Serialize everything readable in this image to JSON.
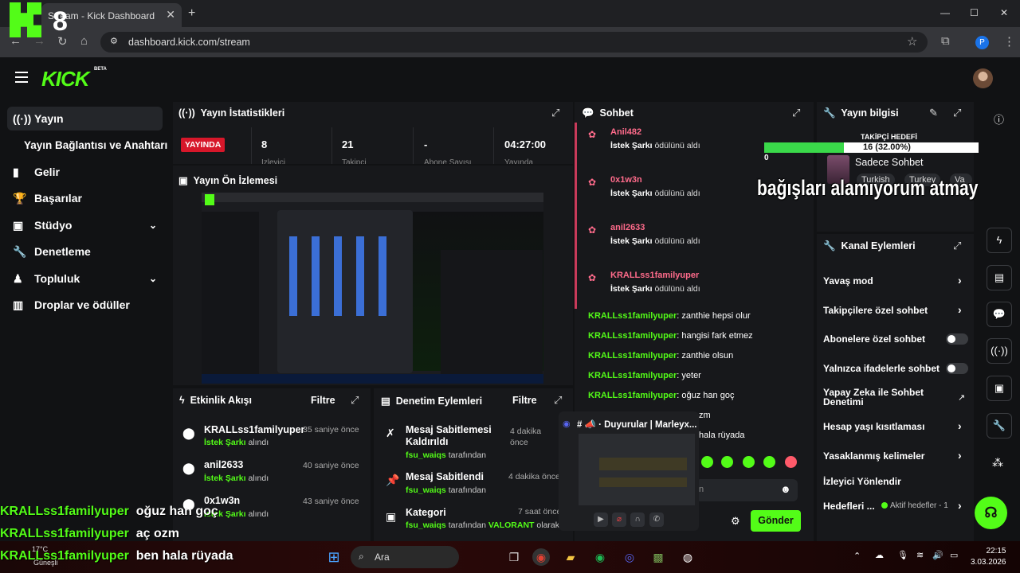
{
  "browser": {
    "tab_title": "Stream - Kick Dashboard",
    "url": "dashboard.kick.com/stream",
    "profile_initial": "P"
  },
  "overlay": {
    "logo_number": "8",
    "top_message": "bağışları alamıyorum atmayın",
    "chat": [
      {
        "user": "KRALLss1familyuper",
        "text": "oğuz han goç"
      },
      {
        "user": "KRALLss1familyuper",
        "text": "aç ozm"
      },
      {
        "user": "KRALLss1familyuper",
        "text": "ben hala rüyada"
      }
    ]
  },
  "brand": {
    "name": "KICK",
    "badge": "BETA"
  },
  "sidebar": {
    "items": [
      {
        "label": "Yayın",
        "icon": "broadcast-icon"
      },
      {
        "label": "Yayın Bağlantısı ve Anahtarı"
      },
      {
        "label": "Gelir",
        "icon": "chart-icon"
      },
      {
        "label": "Başarılar",
        "icon": "trophy-icon"
      },
      {
        "label": "Stüdyo",
        "icon": "studio-icon"
      },
      {
        "label": "Denetleme",
        "icon": "wrench-icon"
      },
      {
        "label": "Topluluk",
        "icon": "community-icon"
      },
      {
        "label": "Droplar ve ödüller",
        "icon": "drops-icon"
      }
    ]
  },
  "stats": {
    "title": "Yayın İstatistikleri",
    "status": "YAYINDA",
    "items": [
      {
        "value": "8",
        "label": "İzleyici"
      },
      {
        "value": "21",
        "label": "Takipçi"
      },
      {
        "value": "-",
        "label": "Abone Sayısı"
      },
      {
        "value": "04:27:00",
        "label": "Yayında"
      }
    ]
  },
  "preview": {
    "title": "Yayın Ön İzlemesi"
  },
  "activity": {
    "title": "Etkinlik Akışı",
    "filter": "Filtre",
    "items": [
      {
        "user": "KRALLss1familyuper",
        "reward": "İstek Şarkı",
        "suffix": "alındı",
        "time": "35 saniye önce"
      },
      {
        "user": "anil2633",
        "reward": "İstek Şarkı",
        "suffix": "alındı",
        "time": "40 saniye önce"
      },
      {
        "user": "0x1w3n",
        "reward": "İstek Şarkı",
        "suffix": "alındı",
        "time": "43 saniye önce"
      }
    ]
  },
  "moderation": {
    "title": "Denetim Eylemleri",
    "filter": "Filtre",
    "items": [
      {
        "action": "Mesaj Sabitlemesi Kaldırıldı",
        "by": "fsu_waiqs",
        "suffix": "tarafından",
        "time": "4 dakika önce"
      },
      {
        "action": "Mesaj Sabitlendi",
        "by": "fsu_waiqs",
        "suffix": "tarafından",
        "time": "4 dakika önce"
      },
      {
        "action": "Kategori",
        "by": "fsu_waiqs",
        "suffix": "tarafından",
        "extra": "VALORANT",
        "extra_suffix": "olarak",
        "time": "7 saat önce"
      }
    ]
  },
  "chat": {
    "title": "Sohbet",
    "redemptions": [
      {
        "user": "Anil482",
        "reward": "İstek Şarkı",
        "suffix": "ödülünü aldı"
      },
      {
        "user": "0x1w3n",
        "reward": "İstek Şarkı",
        "suffix": "ödülünü aldı"
      },
      {
        "user": "anil2633",
        "reward": "İstek Şarkı",
        "suffix": "ödülünü aldı"
      },
      {
        "user": "KRALLss1familyuper",
        "reward": "İstek Şarkı",
        "suffix": "ödülünü aldı"
      }
    ],
    "messages": [
      {
        "user": "KRALLss1familyuper",
        "text": "zanthie hepsi olur"
      },
      {
        "user": "KRALLss1familyuper",
        "text": "hangisi fark etmez"
      },
      {
        "user": "KRALLss1familyuper",
        "text": "zanthie olsun"
      },
      {
        "user": "KRALLss1familyuper",
        "text": "yeter"
      },
      {
        "user": "KRALLss1familyuper",
        "text": "oğuz han goç"
      },
      {
        "user": "",
        "text": "zm"
      },
      {
        "user": "",
        "text": "hala rüyada"
      }
    ],
    "input_partial": "n",
    "send_label": "Gönder"
  },
  "discord_popup": {
    "title": "# 📣 · Duyurular | Marleyx..."
  },
  "stream_info": {
    "title": "Yayın bilgisi",
    "goal_label": "TAKİPÇİ HEDEFİ",
    "goal_text": "16 (32.00%)",
    "goal_progress": 0.32,
    "goal_start": "0",
    "goal_end": "50",
    "stream_title": "Sadece Sohbet",
    "tags": [
      "Turkish",
      "Turkey",
      "Va"
    ]
  },
  "channel_actions": {
    "title": "Kanal Eylemleri",
    "items": [
      {
        "label": "Yavaş mod",
        "type": "chevron"
      },
      {
        "label": "Takipçilere özel sohbet",
        "type": "chevron"
      },
      {
        "label": "Abonelere özel sohbet",
        "type": "toggle"
      },
      {
        "label": "Yalnızca ifadelerle sohbet",
        "type": "toggle"
      },
      {
        "label": "Yapay Zeka ile Sohbet Denetimi",
        "type": "external"
      },
      {
        "label": "Hesap yaşı kısıtlaması",
        "type": "chevron"
      },
      {
        "label": "Yasaklanmış kelimeler",
        "type": "chevron"
      },
      {
        "label": "İzleyici Yönlendir",
        "type": "none"
      },
      {
        "label": "Hedefleri ...",
        "type": "chevron",
        "extra": "Aktif hedefler - 1"
      }
    ]
  },
  "taskbar": {
    "weather": "17°C",
    "weather_place": "Güneşli",
    "search": "Ara",
    "time": "22:15",
    "date": "3.03.2026"
  },
  "colors": {
    "accent": "#53fc18",
    "live": "#d7172a",
    "background": "#111214",
    "panel": "#17181b"
  }
}
